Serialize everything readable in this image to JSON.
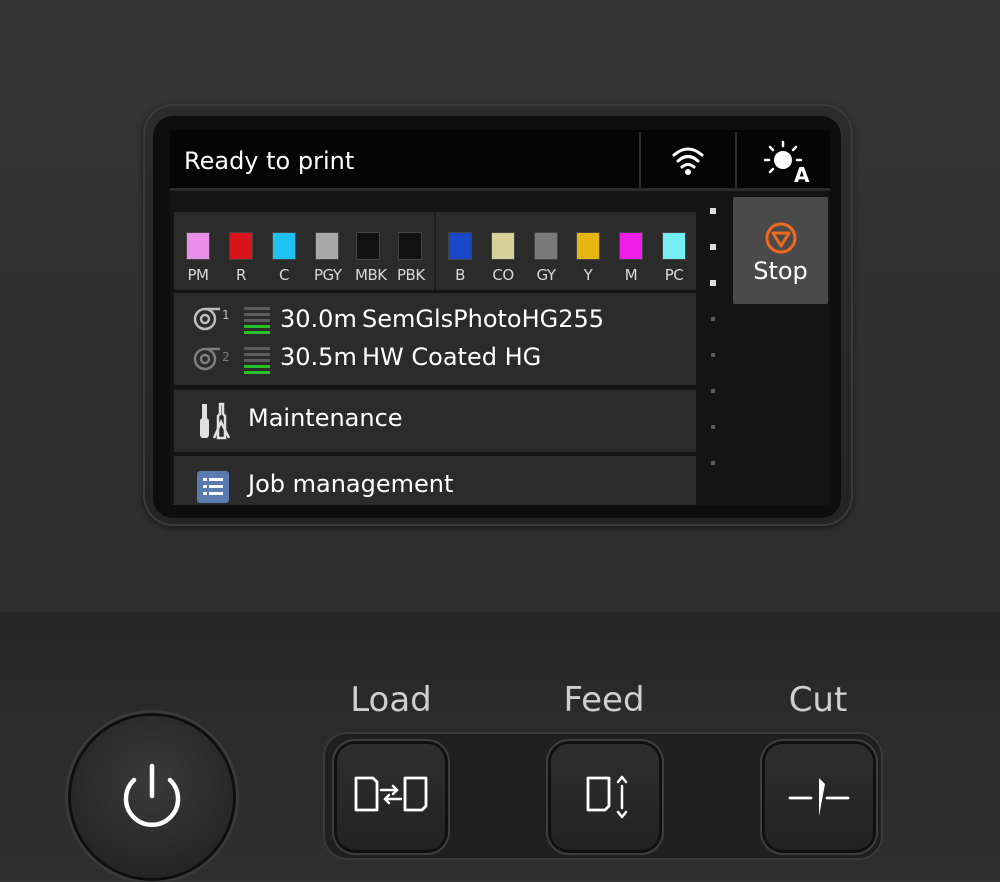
{
  "status": {
    "text": "Ready to print"
  },
  "inks_left": [
    {
      "label": "PM",
      "color": "#e98ee9"
    },
    {
      "label": "R",
      "color": "#d9141c"
    },
    {
      "label": "C",
      "color": "#1ec2f0"
    },
    {
      "label": "PGY",
      "color": "#a8a8a8"
    },
    {
      "label": "MBK",
      "color": "#111111"
    },
    {
      "label": "PBK",
      "color": "#111111"
    }
  ],
  "inks_right": [
    {
      "label": "B",
      "color": "#1848c8"
    },
    {
      "label": "CO",
      "color": "#d6d29a"
    },
    {
      "label": "GY",
      "color": "#7a7a7a"
    },
    {
      "label": "Y",
      "color": "#e4b60e"
    },
    {
      "label": "M",
      "color": "#ee1ee6"
    },
    {
      "label": "PC",
      "color": "#74eef2"
    }
  ],
  "rolls": [
    {
      "number": "1",
      "length": "30.0m",
      "media": "SemGlsPhotoHG255",
      "level_color": "#2bbf2b"
    },
    {
      "number": "2",
      "length": "30.5m",
      "media": "HW Coated HG",
      "level_color": "#2bbf2b"
    }
  ],
  "menu": {
    "maintenance": "Maintenance",
    "job_management": "Job management"
  },
  "stop_button": {
    "label": "Stop",
    "icon": "stop-icon",
    "accent": "#f06a1e"
  },
  "hardware": {
    "load_label": "Load",
    "feed_label": "Feed",
    "cut_label": "Cut"
  }
}
